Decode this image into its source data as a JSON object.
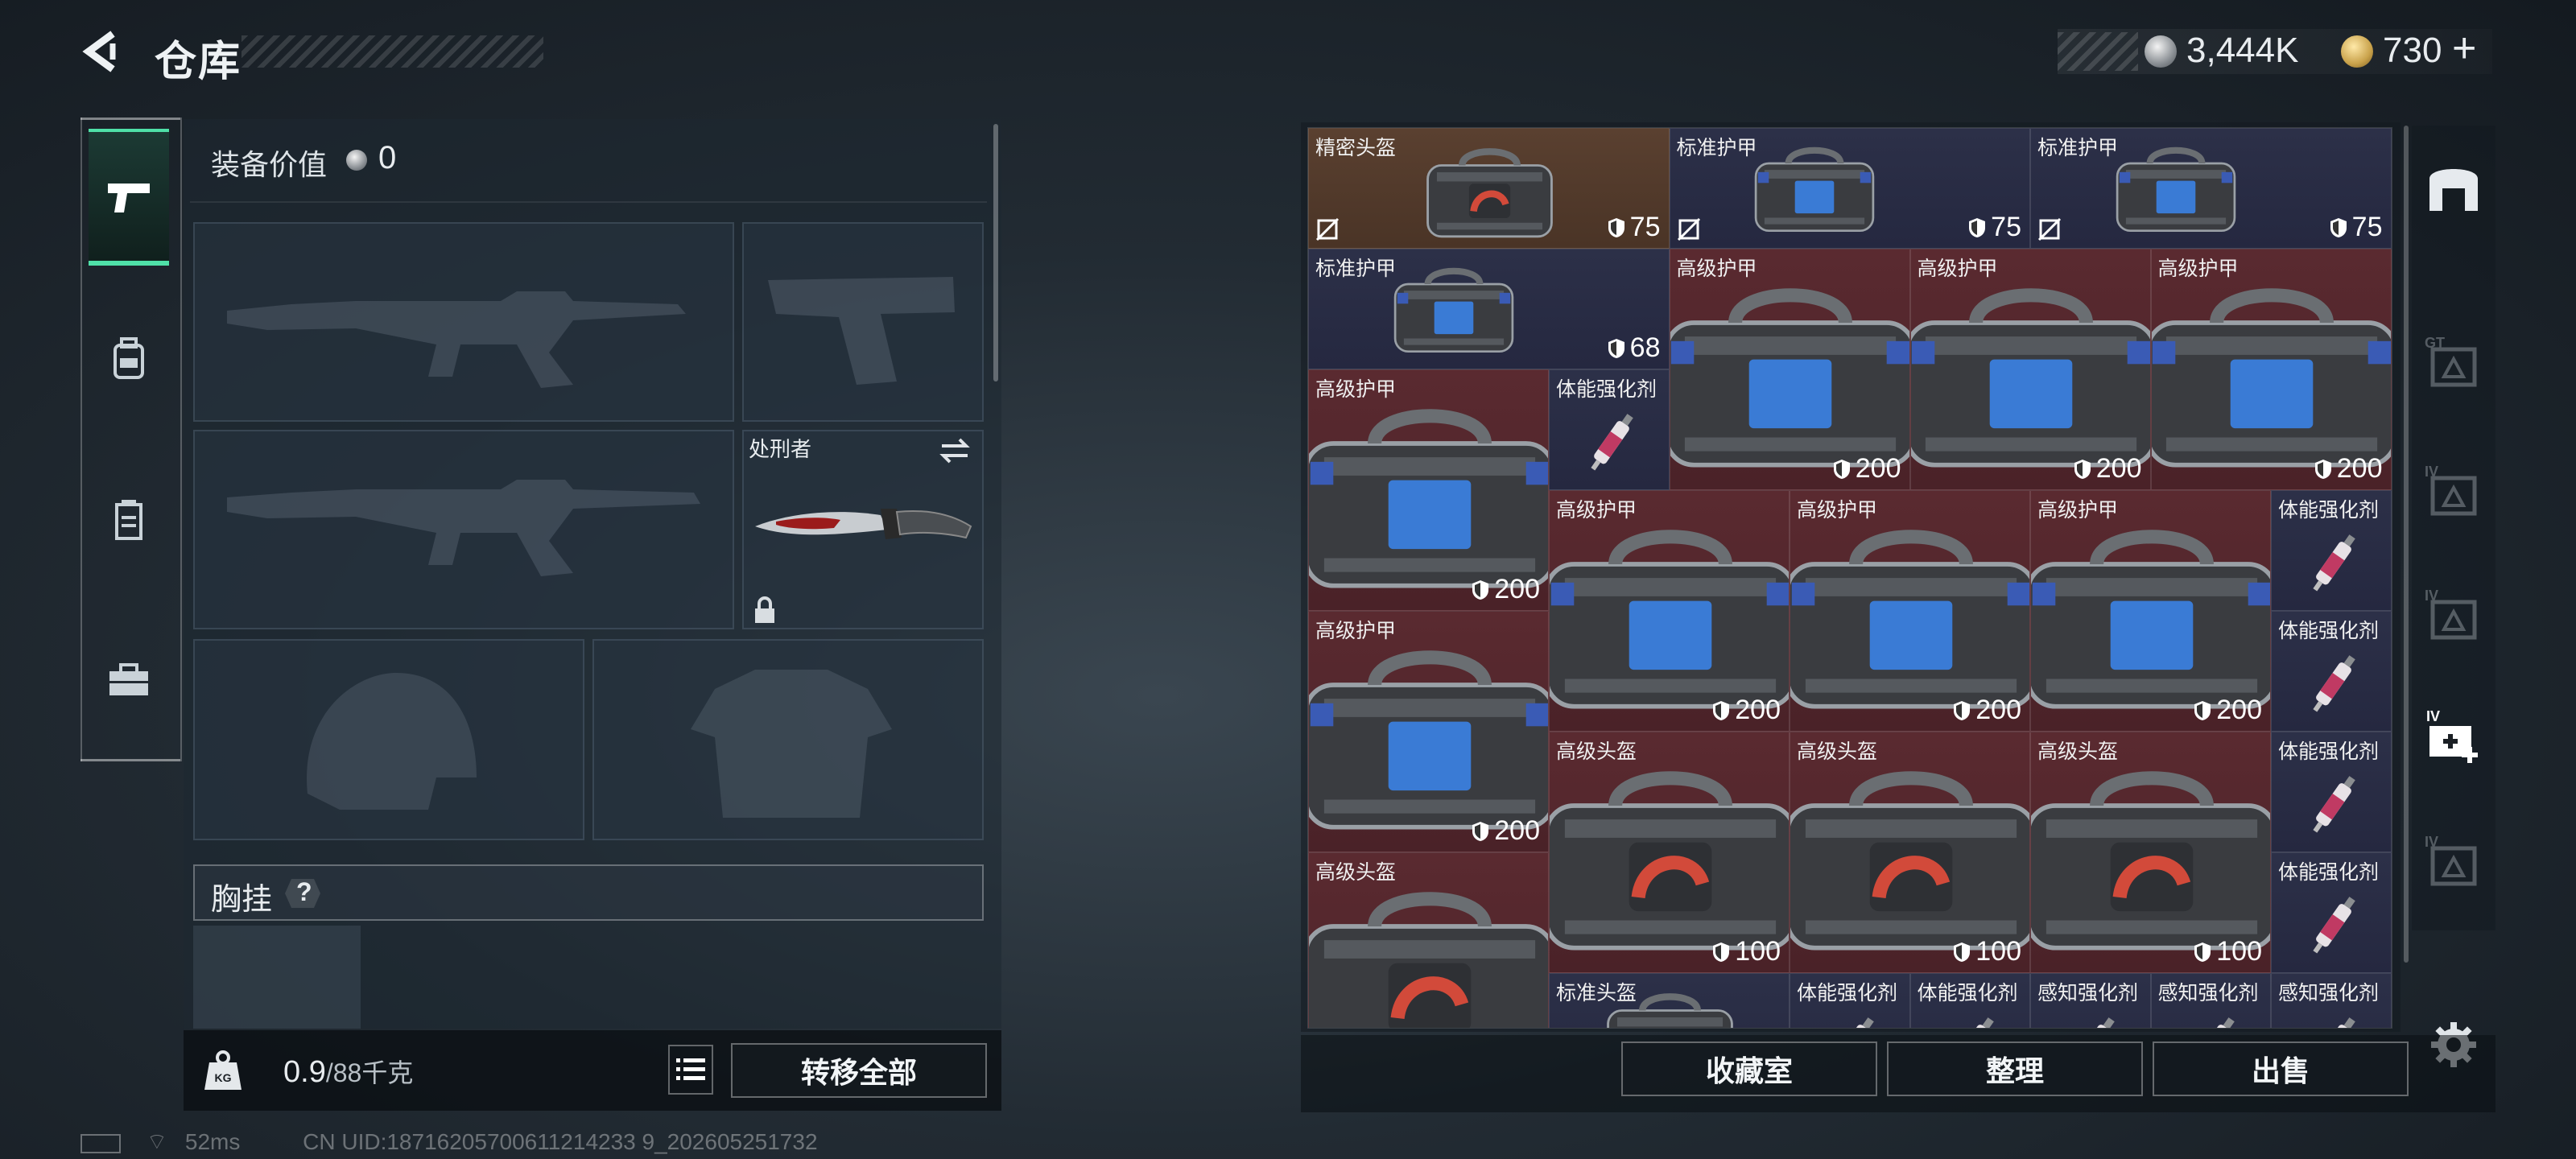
{
  "header": {
    "title": "仓库",
    "currency1": "3,444K",
    "currency2": "730",
    "currency2_plus": "+"
  },
  "left_tabs": [
    {
      "name": "weapons",
      "icon": "pistol-icon",
      "active": true
    },
    {
      "name": "backpack",
      "icon": "backpack-icon",
      "active": false
    },
    {
      "name": "vest",
      "icon": "vest-icon",
      "active": false
    },
    {
      "name": "toolbox",
      "icon": "toolbox-icon",
      "active": false
    }
  ],
  "equipment": {
    "value_label": "装备价值",
    "value": "0",
    "knife_name": "处刑者",
    "chest_rig_label": "胸挂",
    "chest_rig_help": "?"
  },
  "weight": {
    "current": "0.9",
    "max": "/88千克"
  },
  "buttons": {
    "transfer_all": "转移全部",
    "collection": "收藏室",
    "sort": "整理",
    "sell": "出售"
  },
  "status": {
    "ping": "52ms",
    "uid": "CN UID:18716205700611214233 9_202605251732"
  },
  "inventory": [
    {
      "name": "精密头盔",
      "value": "75",
      "kind": "helmet",
      "bg": "gold",
      "no_icon": true
    },
    {
      "name": "标准护甲",
      "value": "75",
      "kind": "armor-small",
      "bg": "blue",
      "no_icon": true
    },
    {
      "name": "标准护甲",
      "value": "75",
      "kind": "armor-small",
      "bg": "blue",
      "no_icon": true
    },
    {
      "name": "标准护甲",
      "value": "68",
      "kind": "armor-small",
      "bg": "blue",
      "no_icon": false
    },
    {
      "name": "高级护甲",
      "value": "200",
      "kind": "armor",
      "bg": "red"
    },
    {
      "name": "高级护甲",
      "value": "200",
      "kind": "armor",
      "bg": "red"
    },
    {
      "name": "高级护甲",
      "value": "200",
      "kind": "armor",
      "bg": "red"
    },
    {
      "name": "高级护甲",
      "value": "200",
      "kind": "armor",
      "bg": "red"
    },
    {
      "name": "体能强化剂",
      "value": "",
      "kind": "syringe",
      "bg": "blue"
    },
    {
      "name": "高级护甲",
      "value": "200",
      "kind": "armor",
      "bg": "red"
    },
    {
      "name": "高级护甲",
      "value": "200",
      "kind": "armor",
      "bg": "red"
    },
    {
      "name": "高级护甲",
      "value": "200",
      "kind": "armor",
      "bg": "red"
    },
    {
      "name": "体能强化剂",
      "value": "",
      "kind": "syringe",
      "bg": "blue"
    },
    {
      "name": "体能强化剂",
      "value": "",
      "kind": "syringe",
      "bg": "blue"
    },
    {
      "name": "高级护甲",
      "value": "200",
      "kind": "armor",
      "bg": "red"
    },
    {
      "name": "高级头盔",
      "value": "100",
      "kind": "helmet",
      "bg": "red"
    },
    {
      "name": "高级头盔",
      "value": "100",
      "kind": "helmet",
      "bg": "red"
    },
    {
      "name": "高级头盔",
      "value": "100",
      "kind": "helmet",
      "bg": "red"
    },
    {
      "name": "体能强化剂",
      "value": "",
      "kind": "syringe",
      "bg": "blue"
    },
    {
      "name": "体能强化剂",
      "value": "",
      "kind": "syringe",
      "bg": "blue"
    },
    {
      "name": "高级头盔",
      "value": "",
      "kind": "helmet",
      "bg": "red"
    },
    {
      "name": "标准头盔",
      "value": "",
      "kind": "helmet",
      "bg": "blue"
    },
    {
      "name": "体能强化剂",
      "value": "",
      "kind": "syringe",
      "bg": "blue"
    },
    {
      "name": "体能强化剂",
      "value": "",
      "kind": "syringe",
      "bg": "blue"
    },
    {
      "name": "感知强化剂",
      "value": "",
      "kind": "syringe",
      "bg": "blue"
    },
    {
      "name": "感知强化剂",
      "value": "",
      "kind": "syringe",
      "bg": "blue"
    },
    {
      "name": "感知强化剂",
      "value": "",
      "kind": "syringe",
      "bg": "blue"
    }
  ],
  "right_bar": [
    "safe-icon",
    "gt-armor-icon",
    "iv-armor-icon",
    "iv-case-icon",
    "iv-medkit-plus-icon",
    "iv-medkit-icon"
  ],
  "colors": {
    "accent": "#4fe0a8",
    "red_item": "#5a2a30",
    "blue_item": "#2c3048",
    "gold_item": "#5a4030"
  }
}
